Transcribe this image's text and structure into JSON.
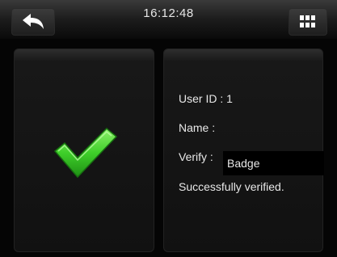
{
  "header": {
    "time": "16:12:48",
    "back_icon": "back-arrow-icon",
    "menu_icon": "grid-menu-icon"
  },
  "result": {
    "status_icon": "success-check-icon",
    "check_color": "#3fcf2a"
  },
  "details": {
    "user_id_label": "User ID :",
    "user_id_value": "1",
    "name_label": "Name :",
    "name_value": "",
    "verify_label": "Verify :",
    "verify_value": "Badge",
    "message": "Successfully verified."
  }
}
